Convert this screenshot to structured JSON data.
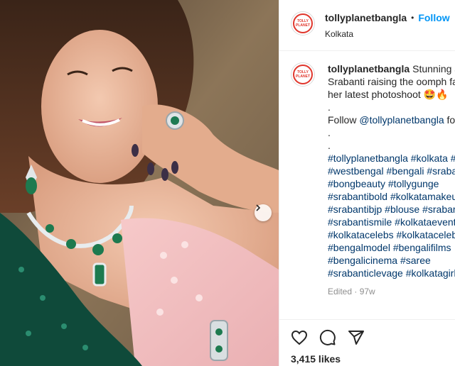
{
  "post": {
    "username": "tollyplanetbangla",
    "follow_label": "Follow",
    "separator": "•",
    "location": "Kolkata",
    "avatar_text_1": "TOLLY",
    "avatar_text_2": "PLANET",
    "avatar_text_3": "বাংলা"
  },
  "caption": {
    "username": "tollyplanetbangla",
    "line1": "Stunning a",
    "line2": "Srabanti raising the oomph fa",
    "line3": "her latest photoshoot 🤩🔥",
    "line4": ".",
    "follow_prefix": "Follow ",
    "follow_mention": "@tollyplanetbangla",
    "follow_suffix": " fo",
    "line6": ".",
    "line7": ".",
    "hashtag_lines": [
      "#tollyplanetbangla #kolkata #",
      "#westbengal #bengali #sraba",
      "#bongbeauty #tollygunge",
      "#srabantibold #kolkatamakeu",
      "#srabantibjp #blouse #srabar",
      "#srabantismile #kolkataevent",
      "#kolkatacelebs #kolkatacelebi",
      "#bengalmodel #bengalifilms",
      "#bengalicinema #saree",
      "#srabanticlevage #kolkatagirl"
    ],
    "meta": "Edited · 97w"
  },
  "actions": {
    "like_icon": "heart-icon",
    "comment_icon": "comment-icon",
    "share_icon": "share-icon",
    "likes": "3,415 likes"
  },
  "media": {
    "next_icon": "chevron-right-icon"
  }
}
